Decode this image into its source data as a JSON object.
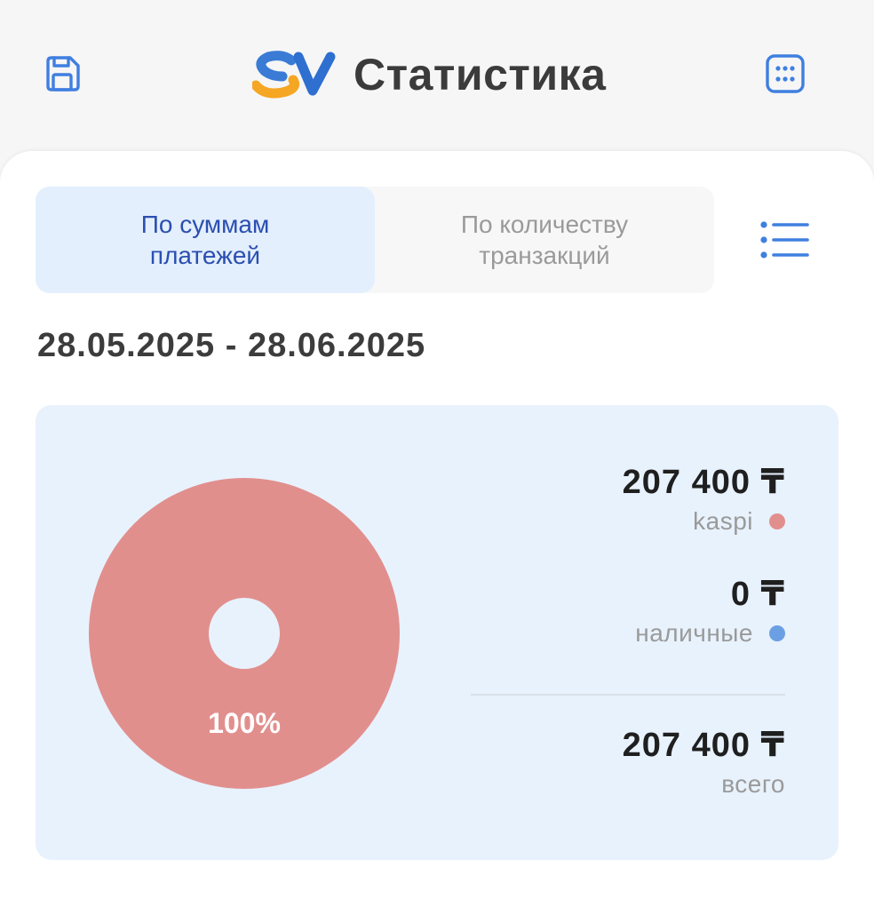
{
  "header": {
    "title": "Статистика",
    "save_icon": "save-icon",
    "grid_icon": "grid-menu-icon",
    "logo_letters": "SV"
  },
  "tabs": [
    {
      "label": "По суммам платежей",
      "active": true
    },
    {
      "label": "По количеству транзакций",
      "active": false
    }
  ],
  "list_icon": "list-icon",
  "date_range": "28.05.2025 - 28.06.2025",
  "summary": {
    "kaspi": {
      "amount": "207 400 ₸",
      "label": "kaspi",
      "color": "#e18f8d"
    },
    "cash": {
      "amount": "0 ₸",
      "label": "наличные",
      "color": "#6b9fe4"
    },
    "total": {
      "amount": "207 400 ₸",
      "label": "всего"
    }
  },
  "colors": {
    "accent": "#3f7fe0",
    "active_tab_bg": "#e3effd",
    "active_tab_text": "#2b4fb0",
    "panel_bg": "#e8f2fd"
  },
  "chart_data": {
    "type": "pie",
    "categories": [
      "kaspi",
      "наличные"
    ],
    "values": [
      207400,
      0
    ],
    "labels": [
      "100%"
    ],
    "colors": [
      "#e18f8d",
      "#6b9fe4"
    ],
    "donut": true
  }
}
